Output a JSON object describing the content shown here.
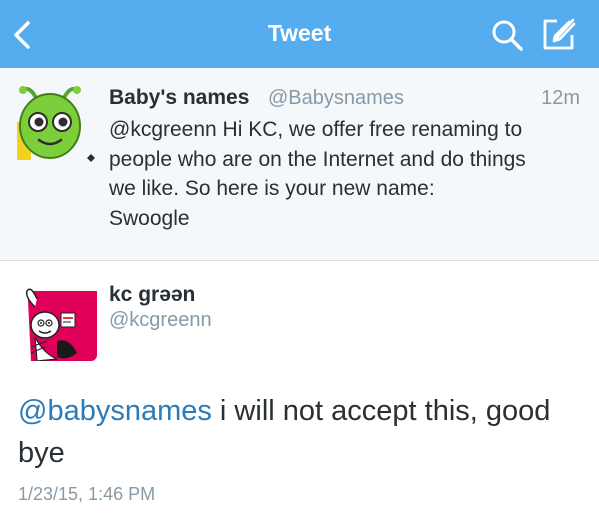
{
  "navbar": {
    "title": "Tweet",
    "back_icon": "chevron-left-icon",
    "search_icon": "search-icon",
    "compose_icon": "compose-icon",
    "background_color": "#55acee"
  },
  "parent_tweet": {
    "author_name": "Baby's names",
    "handle": "@Babysnames",
    "time": "12m",
    "text": "@kcgreenn Hi KC, we offer free renaming to\npeople who are on the Internet and do things\nwe like. So here is your new name:\nSwoogle",
    "avatar": "green-alien-avatar",
    "background_color": "#f5f8fa"
  },
  "main_tweet": {
    "author_name": "kc grəən",
    "handle": "@kcgreenn",
    "mention": "@babysnames",
    "text_rest": " i will not accept this, good bye",
    "date": "1/23/15, 1:46 PM",
    "avatar": "cartoon-character-avatar",
    "mention_color": "#2b7bb9"
  }
}
